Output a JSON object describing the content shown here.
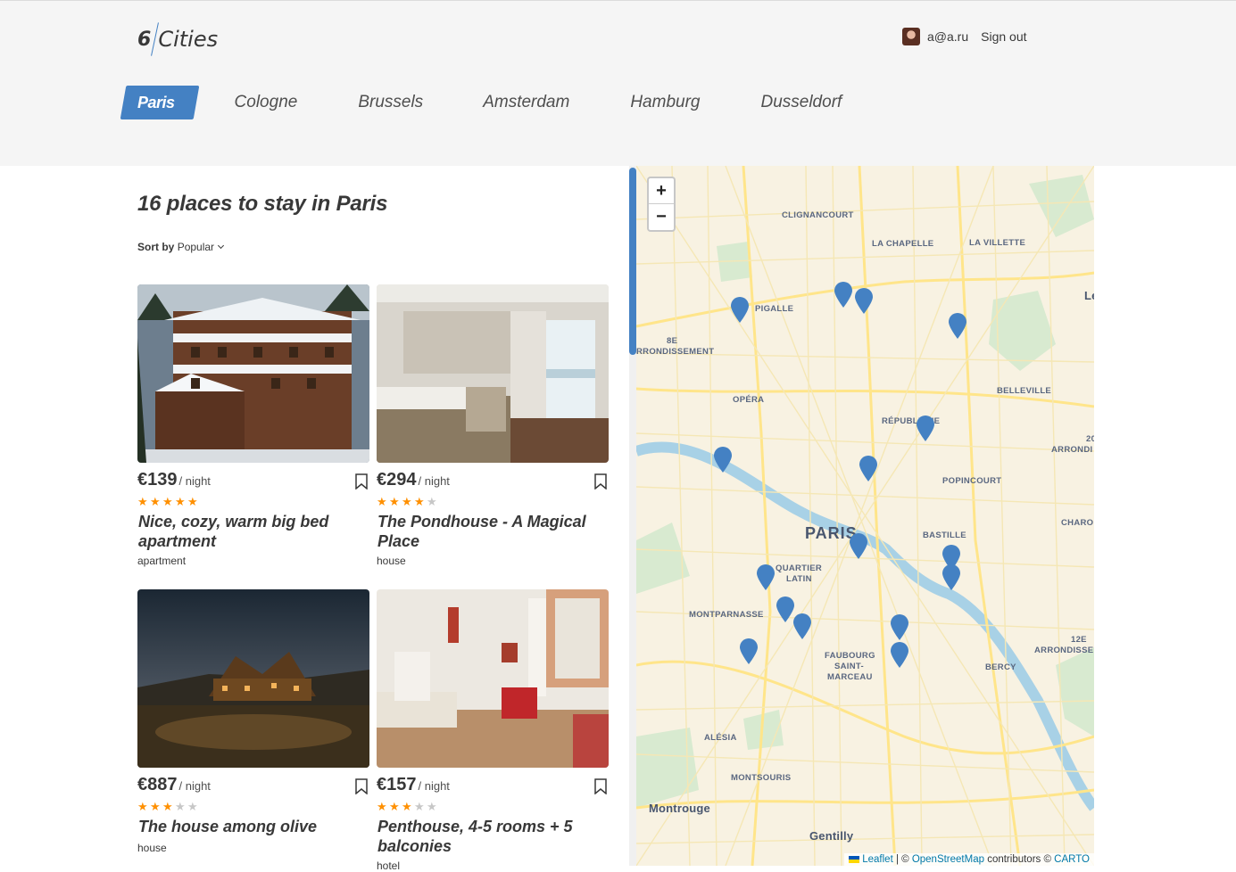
{
  "header": {
    "logo_number": "6",
    "logo_word": "Cities",
    "user_email": "a@a.ru",
    "signout_label": "Sign out"
  },
  "tabs": [
    {
      "label": "Paris",
      "active": true
    },
    {
      "label": "Cologne",
      "active": false
    },
    {
      "label": "Brussels",
      "active": false
    },
    {
      "label": "Amsterdam",
      "active": false
    },
    {
      "label": "Hamburg",
      "active": false
    },
    {
      "label": "Dusseldorf",
      "active": false
    }
  ],
  "places": {
    "title": "16 places to stay in Paris",
    "sort_label": "Sort by",
    "sort_value": "Popular",
    "cards": [
      {
        "price": "€139",
        "per": "/ night",
        "rating": 5,
        "title": "Nice, cozy, warm big bed apartment",
        "type": "apartment"
      },
      {
        "price": "€294",
        "per": "/ night",
        "rating": 4,
        "title": "The Pondhouse - A Magical Place",
        "type": "house"
      },
      {
        "price": "€887",
        "per": "/ night",
        "rating": 3,
        "title": "The house among olive",
        "type": "house"
      },
      {
        "price": "€157",
        "per": "/ night",
        "rating": 3,
        "title": "Penthouse, 4-5 rooms + 5 balconies",
        "type": "hotel"
      }
    ]
  },
  "map": {
    "zoom_in": "+",
    "zoom_out": "−",
    "labels": {
      "clignancourt": "CLIGNANCOURT",
      "lachapelle": "LA CHAPELLE",
      "lavillette": "LA VILLETTE",
      "pigalle": "PIGALLE",
      "arr8a": "8E",
      "arr8b": "RRONDISSEMENT",
      "opera": "OPÉRA",
      "belleville": "BELLEVILLE",
      "republique": "RÉPUBLIQUE",
      "popincourt": "POPINCOURT",
      "paris": "PARIS",
      "bastille": "BASTILLE",
      "quartier": "QUARTIER",
      "latin": "LATIN",
      "montparnasse": "MONTPARNASSE",
      "faubourg": "FAUBOURG",
      "saint": "SAINT-",
      "marceau": "MARCEAU",
      "alesia": "ALÉSIA",
      "montsouris": "MONTSOURIS",
      "bercy": "BERCY",
      "montrouge": "Montrouge",
      "gentilly": "Gentilly",
      "le": "Le",
      "arr20a": "20",
      "arr20b": "ARRONDI",
      "charo": "CHARO",
      "arr12a": "12E",
      "arr12b": "ARRONDISSE"
    },
    "attribution": {
      "leaflet": "Leaflet",
      "sep": " | © ",
      "osm": "OpenStreetMap",
      "contrib": " contributors © ",
      "carto": "CARTO"
    },
    "pin_color": "#4481c3"
  },
  "colors": {
    "accent": "#4481c3",
    "star": "#ff9000"
  }
}
